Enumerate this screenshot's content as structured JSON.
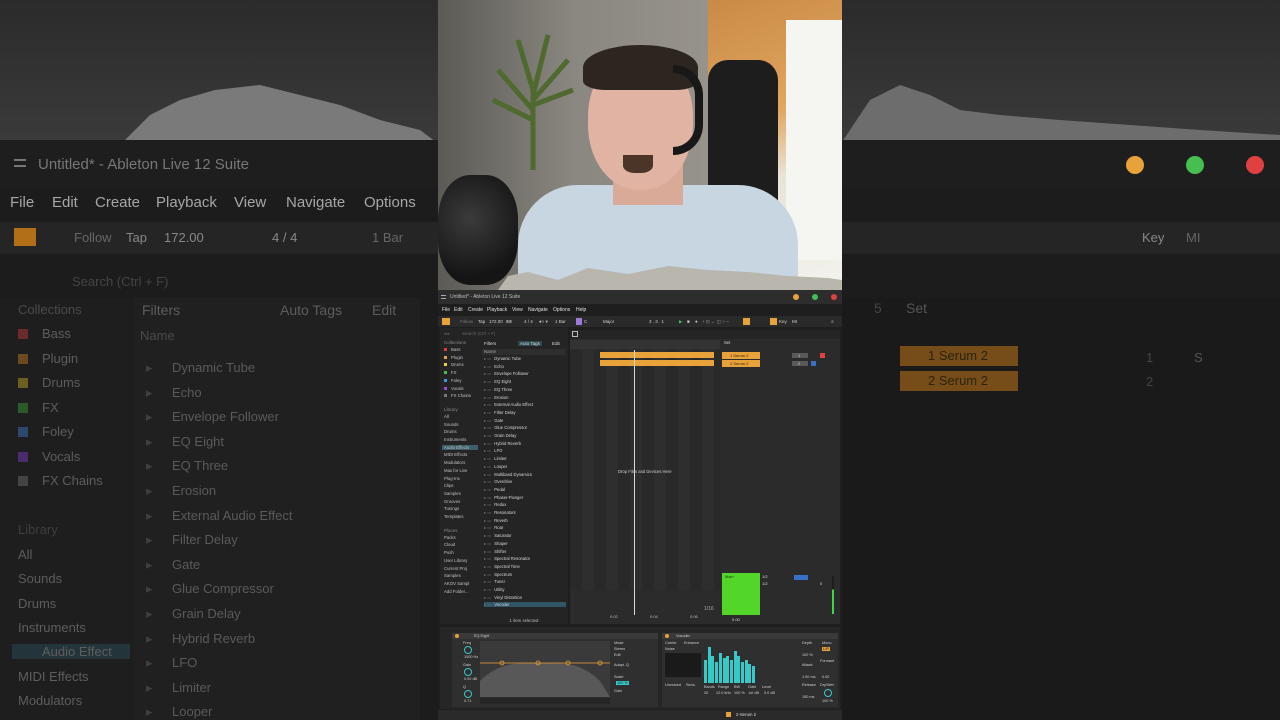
{
  "window": {
    "title": "Untitled* - Ableton Live 12 Suite",
    "dots": [
      "#e8a23a",
      "#45c050",
      "#e04040"
    ]
  },
  "menu": [
    "File",
    "Edit",
    "Create",
    "Playback",
    "View",
    "Navigate",
    "Options",
    "Help"
  ],
  "transport": {
    "follow": "Follow",
    "tap": "Tap",
    "tempo": "172.00",
    "signature": "4 / 4",
    "quantize": "1 Bar",
    "key": "Key",
    "mi": "MI",
    "scale": "Major",
    "position": "3 . 3 . 1",
    "root": "C"
  },
  "browser": {
    "search_placeholder": "Search (Ctrl + F)",
    "collections_header": "Collections",
    "collections": [
      {
        "label": "Bass",
        "color": "#e03a3a"
      },
      {
        "label": "Plugin",
        "color": "#e8a23a"
      },
      {
        "label": "Drums",
        "color": "#e8d13a"
      },
      {
        "label": "FX",
        "color": "#45c050"
      },
      {
        "label": "Foley",
        "color": "#3a9fe0"
      },
      {
        "label": "Vocals",
        "color": "#9c4ae0"
      },
      {
        "label": "FX Chains",
        "color": "#777777"
      }
    ],
    "library_header": "Library",
    "library": [
      "All",
      "Sounds",
      "Drums",
      "Instruments",
      "Audio Effects",
      "MIDI Effects",
      "Modulators",
      "Max for Live",
      "Plug-Ins",
      "Clips",
      "Samples",
      "Grooves",
      "Tunings",
      "Templates"
    ],
    "places_header": "Places",
    "places": [
      "Packs",
      "Cloud",
      "Push",
      "User Library",
      "Current Proj",
      "Samples",
      "AKOV Sampl",
      "Add Folder..."
    ],
    "filters_label": "Filters",
    "auto_tags_label": "Auto Tags",
    "edit_label": "Edit",
    "name_header": "Name",
    "items": [
      "Dynamic Tube",
      "Echo",
      "Envelope Follower",
      "EQ Eight",
      "EQ Three",
      "Erosion",
      "External Audio Effect",
      "Filter Delay",
      "Gate",
      "Glue Compressor",
      "Grain Delay",
      "Hybrid Reverb",
      "LFO",
      "Limiter",
      "Looper",
      "Multiband Dynamics",
      "Overdrive",
      "Pedal",
      "Phaser-Flanger",
      "Redux",
      "Resonators",
      "Reverb",
      "Roar",
      "Saturator",
      "Shaper",
      "Shifter",
      "Spectral Resonator",
      "Spectral Time",
      "Spectrum",
      "Tuner",
      "Utility",
      "Vinyl Distortion",
      "Vocoder"
    ],
    "footer": "1 item selected"
  },
  "arrangement": {
    "set_label": "Set",
    "tracks": [
      {
        "name": "1 Serum 2",
        "number": "1",
        "color": "#e8a23a"
      },
      {
        "name": "2 Serum 2",
        "number": "2",
        "color": "#e8a23a"
      }
    ],
    "drop_hint": "Drop Files and Devices Here",
    "master_label": "Main",
    "routing": [
      "1/2",
      "1/2"
    ],
    "master_value": "0",
    "ruler": [
      "0:02",
      "0:04",
      "0:06"
    ],
    "grid": "1/16",
    "zoom": "0.00"
  },
  "devices": {
    "eq_title": "EQ Eight",
    "eq_labels": [
      "Freq",
      "Gain",
      "Q",
      "Mode",
      "Stereo",
      "Edit",
      "Adapt. Q",
      "Scale",
      "Gain"
    ],
    "eq_values": [
      "1000 Hz",
      "0.00 dB",
      "0.71",
      "100 %"
    ],
    "ring_title": "Vocoder",
    "ring_labels": [
      "Carrier",
      "Enhance",
      "Noise",
      "Unvoiced",
      "Sens.",
      "Bands",
      "Range",
      "BW",
      "Gate",
      "Level",
      "Depth",
      "Attack",
      "Release",
      "Formant",
      "Dry/Wet",
      "Mono",
      "L/R"
    ],
    "ring_values": [
      "20",
      "12.0 kHz",
      "100 %",
      "-inf dB",
      "0.0 dB",
      "100 %",
      "1.00 ms",
      "150 ms",
      "0.00",
      "100 %"
    ]
  },
  "status": {
    "track": "2-Serum 2"
  },
  "bg": {
    "title": "Untitled* - Ableton Live 12 Suite",
    "menu": [
      "File",
      "Edit",
      "Create",
      "Playback",
      "View",
      "Navigate",
      "Options"
    ],
    "follow": "Follow",
    "tap": "Tap",
    "tempo": "172.00",
    "signature": "4 / 4",
    "quantize": "1 Bar",
    "key": "Key",
    "mi": "MI",
    "search": "Search (Ctrl + F)",
    "collections_header": "Collections",
    "library_header": "Library",
    "filters": "Filters",
    "auto_tags": "Auto Tags",
    "edit": "Edit",
    "name": "Name",
    "side_items": [
      "Bass",
      "Plugin",
      "Drums",
      "FX",
      "Foley",
      "Vocals",
      "FX Chains"
    ],
    "library_items": [
      "All",
      "Sounds",
      "Drums",
      "Instruments",
      "Audio Effect",
      "MIDI Effects",
      "Modulators"
    ],
    "list_items": [
      "Dynamic Tube",
      "Echo",
      "Envelope Follower",
      "EQ Eight",
      "EQ Three",
      "Erosion",
      "External Audio Effect",
      "Filter Delay",
      "Gate",
      "Glue Compressor",
      "Grain Delay",
      "Hybrid Reverb",
      "LFO",
      "Limiter",
      "Looper"
    ],
    "tracks": [
      "1 Serum 2",
      "2 Serum 2"
    ],
    "numbers": [
      "1",
      "2"
    ],
    "set": "Set",
    "num5": "5",
    "s_label": "S"
  }
}
